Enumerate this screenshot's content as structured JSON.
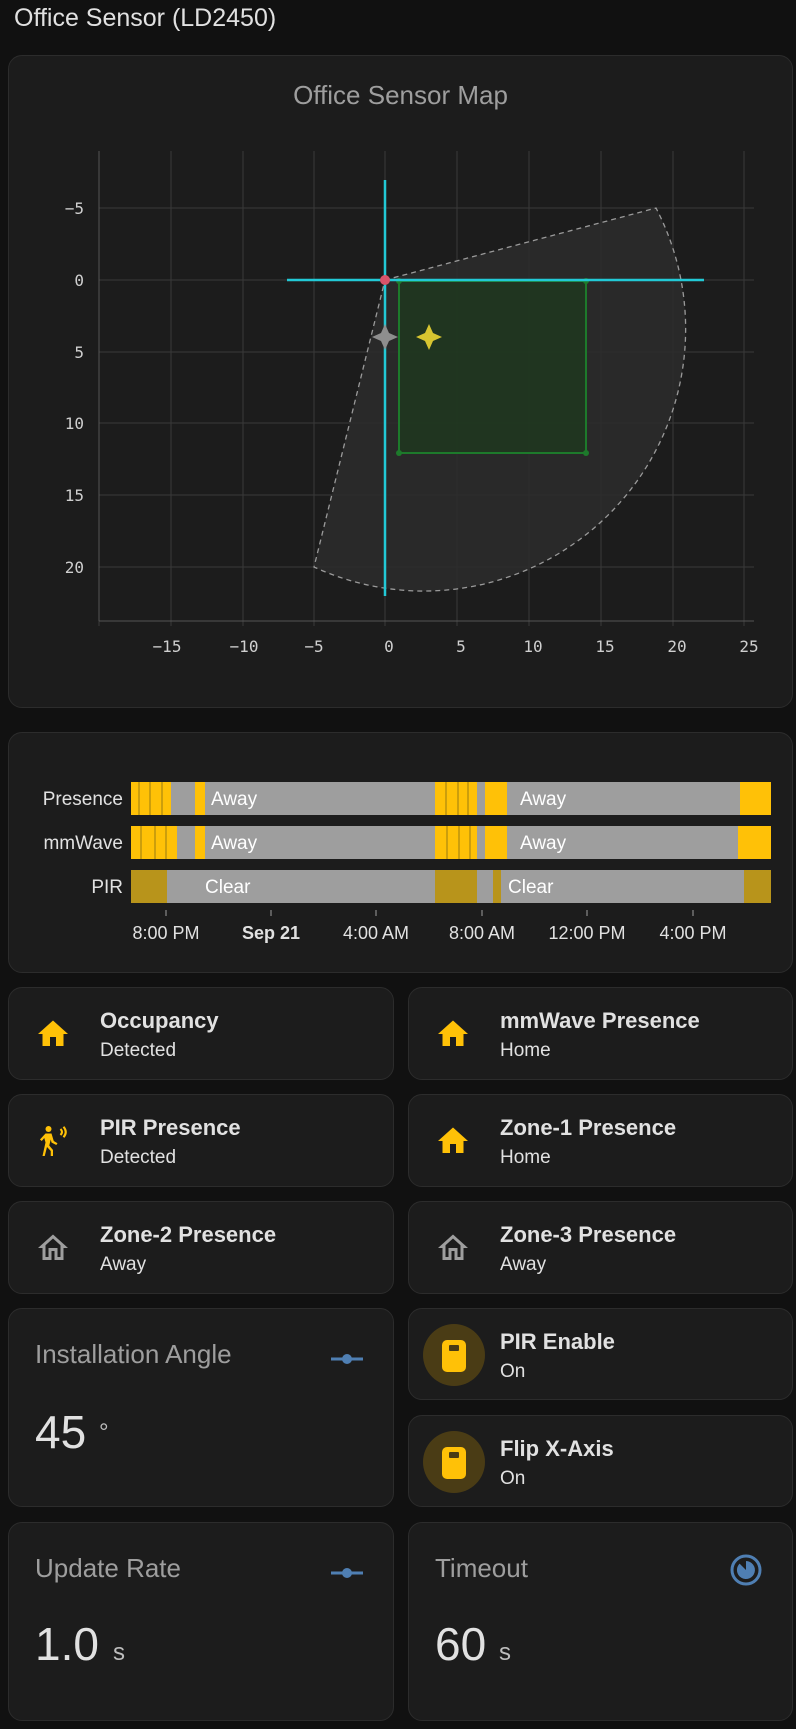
{
  "page": {
    "title": "Office Sensor (LD2450)"
  },
  "map": {
    "title": "Office Sensor Map",
    "x_ticks": [
      "−15",
      "−10",
      "−5",
      "0",
      "5",
      "10",
      "15",
      "20",
      "25"
    ],
    "y_ticks": [
      "−5",
      "0",
      "5",
      "10",
      "15",
      "20"
    ],
    "colors": {
      "axis": "#22c9d6",
      "zone": "#1d7a2b",
      "target": "#d7c530",
      "sensor": "#d9546a"
    }
  },
  "history": {
    "rows": [
      {
        "label": "Presence",
        "states": [
          "Away",
          "Away"
        ]
      },
      {
        "label": "mmWave",
        "states": [
          "Away",
          "Away"
        ]
      },
      {
        "label": "PIR",
        "states": [
          "Clear",
          "Clear"
        ]
      }
    ],
    "x_ticks": [
      "8:00 PM",
      "Sep 21",
      "4:00 AM",
      "8:00 AM",
      "12:00 PM",
      "4:00 PM"
    ],
    "colors": {
      "on": "#ffc107",
      "off": "#9e9e9e"
    }
  },
  "tiles": [
    {
      "name": "Occupancy",
      "state": "Detected",
      "icon": "home-icon"
    },
    {
      "name": "mmWave Presence",
      "state": "Home",
      "icon": "home-icon"
    },
    {
      "name": "PIR Presence",
      "state": "Detected",
      "icon": "motion-sensor-icon"
    },
    {
      "name": "Zone-1 Presence",
      "state": "Home",
      "icon": "home-icon"
    },
    {
      "name": "Zone-2 Presence",
      "state": "Away",
      "icon": "home-outline-icon"
    },
    {
      "name": "Zone-3 Presence",
      "state": "Away",
      "icon": "home-outline-icon"
    }
  ],
  "installation_angle": {
    "label": "Installation Angle",
    "value": "45",
    "unit": "°",
    "icon": "slider-icon"
  },
  "pir_enable": {
    "name": "PIR Enable",
    "state": "On",
    "icon": "switch-icon"
  },
  "flip_x": {
    "name": "Flip X-Axis",
    "state": "On",
    "icon": "switch-icon"
  },
  "update_rate": {
    "label": "Update Rate",
    "value": "1.0",
    "unit": "s",
    "icon": "slider-icon"
  },
  "timeout": {
    "label": "Timeout",
    "value": "60",
    "unit": "s",
    "icon": "timer-icon"
  },
  "colors": {
    "accent": "#ffc107",
    "slider": "#4f7fb3",
    "background": "#111111",
    "card": "#1c1c1c"
  }
}
